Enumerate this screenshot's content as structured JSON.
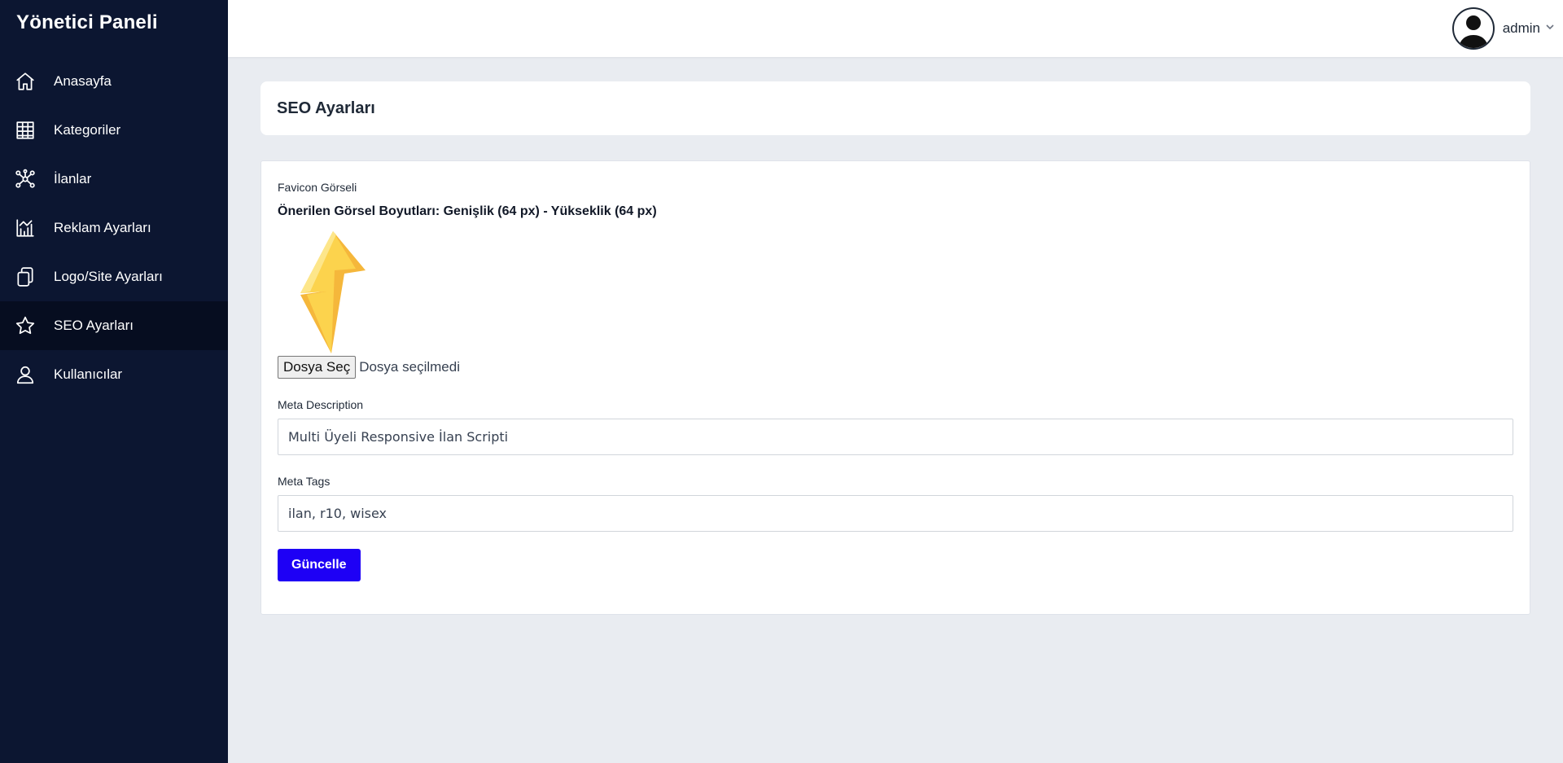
{
  "sidebar": {
    "brand": "Yönetici Paneli",
    "items": [
      {
        "label": "Anasayfa",
        "icon": "home-icon"
      },
      {
        "label": "Kategoriler",
        "icon": "grid-icon"
      },
      {
        "label": "İlanlar",
        "icon": "network-icon"
      },
      {
        "label": "Reklam Ayarları",
        "icon": "chart-icon"
      },
      {
        "label": "Logo/Site Ayarları",
        "icon": "copy-icon"
      },
      {
        "label": "SEO Ayarları",
        "icon": "star-icon",
        "active": true
      },
      {
        "label": "Kullanıcılar",
        "icon": "user-icon"
      }
    ]
  },
  "topbar": {
    "username": "admin",
    "avatar_icon": "avatar-silhouette-icon",
    "dropdown_icon": "chevron-down-icon"
  },
  "page": {
    "title": "SEO Ayarları"
  },
  "form": {
    "favicon_label": "Favicon Görseli",
    "favicon_hint": "Önerilen Görsel Boyutları: Genişlik (64 px) - Yükseklik (64 px)",
    "favicon_image": "lightning-bolt-icon",
    "file_button": "Dosya Seç",
    "file_status": "Dosya seçilmedi",
    "meta_description_label": "Meta Description",
    "meta_description_value": "Multi Üyeli Responsive İlan Scripti",
    "meta_tags_label": "Meta Tags",
    "meta_tags_value": "ilan, r10, wisex",
    "submit_label": "Güncelle"
  },
  "colors": {
    "sidebar_bg": "#0c1631",
    "sidebar_active_bg": "#060d20",
    "page_bg": "#e9ecf1",
    "primary_button": "#1e00f5",
    "bolt_yellow": "#fcd34d",
    "bolt_orange": "#f5b73b"
  }
}
